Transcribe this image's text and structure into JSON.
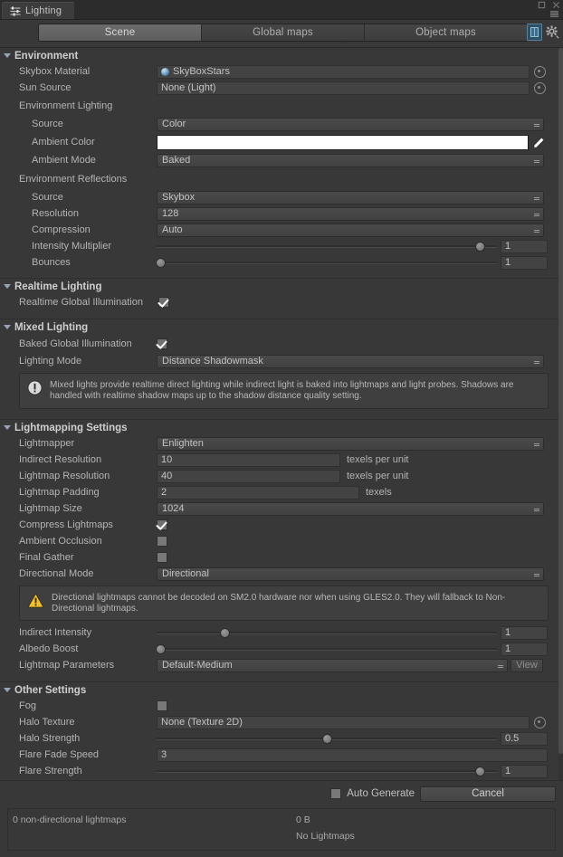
{
  "window": {
    "tab_title": "Lighting",
    "tab_icon": "sliders-icon",
    "maximize_icon": "maximize-icon",
    "close_icon": "close-icon",
    "menu_icon": "hamburger-menu-icon",
    "book_icon": "lightmap-preview-icon",
    "gear_icon": "gear-icon"
  },
  "mode_tabs": [
    {
      "label": "Scene",
      "active": true
    },
    {
      "label": "Global maps",
      "active": false
    },
    {
      "label": "Object maps",
      "active": false
    }
  ],
  "environment": {
    "header": "Environment",
    "skybox_material_label": "Skybox Material",
    "skybox_material_value": "SkyBoxStars",
    "sun_source_label": "Sun Source",
    "sun_source_value": "None (Light)",
    "lighting_group": "Environment Lighting",
    "source_label": "Source",
    "source_value": "Color",
    "ambient_color_label": "Ambient Color",
    "ambient_color_value": "#FFFFFF",
    "ambient_mode_label": "Ambient Mode",
    "ambient_mode_value": "Baked",
    "reflections_group": "Environment Reflections",
    "refl_source_label": "Source",
    "refl_source_value": "Skybox",
    "resolution_label": "Resolution",
    "resolution_value": "128",
    "compression_label": "Compression",
    "compression_value": "Auto",
    "intensity_multiplier_label": "Intensity Multiplier",
    "intensity_multiplier_value": "1",
    "intensity_multiplier_pct": 95,
    "bounces_label": "Bounces",
    "bounces_value": "1",
    "bounces_pct": 1
  },
  "realtime_lighting": {
    "header": "Realtime Lighting",
    "realtime_gi_label": "Realtime Global Illumination",
    "realtime_gi_checked": true
  },
  "mixed_lighting": {
    "header": "Mixed Lighting",
    "baked_gi_label": "Baked Global Illumination",
    "baked_gi_checked": true,
    "lighting_mode_label": "Lighting Mode",
    "lighting_mode_value": "Distance Shadowmask",
    "info_icon": "info-icon",
    "info_text": "Mixed lights provide realtime direct lighting while indirect light is baked into lightmaps and light probes. Shadows are handled with realtime shadow maps up to the shadow distance quality setting."
  },
  "lightmapping": {
    "header": "Lightmapping Settings",
    "lightmapper_label": "Lightmapper",
    "lightmapper_value": "Enlighten",
    "indirect_resolution_label": "Indirect Resolution",
    "indirect_resolution_value": "10",
    "indirect_resolution_unit": "texels per unit",
    "lightmap_resolution_label": "Lightmap Resolution",
    "lightmap_resolution_value": "40",
    "lightmap_resolution_unit": "texels per unit",
    "lightmap_padding_label": "Lightmap Padding",
    "lightmap_padding_value": "2",
    "lightmap_padding_unit": "texels",
    "lightmap_size_label": "Lightmap Size",
    "lightmap_size_value": "1024",
    "compress_lightmaps_label": "Compress Lightmaps",
    "compress_lightmaps_checked": true,
    "ambient_occlusion_label": "Ambient Occlusion",
    "ambient_occlusion_checked": false,
    "final_gather_label": "Final Gather",
    "final_gather_checked": false,
    "directional_mode_label": "Directional Mode",
    "directional_mode_value": "Directional",
    "warn_icon": "warning-icon",
    "warn_text": "Directional lightmaps cannot be decoded on SM2.0 hardware nor when using GLES2.0. They will fallback to Non-Directional lightmaps.",
    "indirect_intensity_label": "Indirect Intensity",
    "indirect_intensity_value": "1",
    "indirect_intensity_pct": 20,
    "albedo_boost_label": "Albedo Boost",
    "albedo_boost_value": "1",
    "albedo_boost_pct": 1,
    "lightmap_parameters_label": "Lightmap Parameters",
    "lightmap_parameters_value": "Default-Medium",
    "view_button_label": "View"
  },
  "other_settings": {
    "header": "Other Settings",
    "fog_label": "Fog",
    "fog_checked": false,
    "halo_texture_label": "Halo Texture",
    "halo_texture_value": "None (Texture 2D)",
    "halo_strength_label": "Halo Strength",
    "halo_strength_value": "0.5",
    "halo_strength_pct": 50,
    "flare_fade_speed_label": "Flare Fade Speed",
    "flare_fade_speed_value": "3",
    "flare_strength_label": "Flare Strength",
    "flare_strength_value": "1",
    "flare_strength_pct": 95
  },
  "footer": {
    "auto_generate_label": "Auto Generate",
    "auto_generate_checked": false,
    "cancel_label": "Cancel",
    "status_lightmaps": "0 non-directional lightmaps",
    "status_size": "0 B",
    "status_note": "No Lightmaps"
  },
  "colors": {
    "bg": "#383838",
    "accent_tab": "#6b6b6b",
    "text": "#b4b4b4",
    "triangle": "#9aa3b5"
  }
}
